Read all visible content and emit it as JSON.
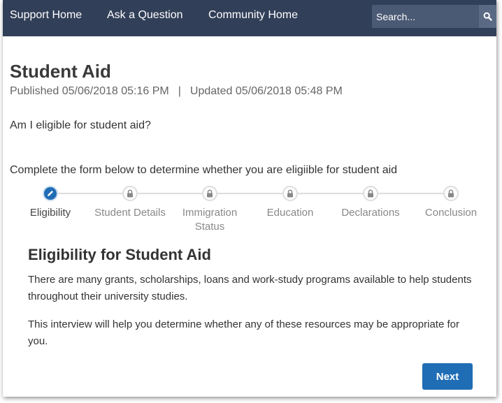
{
  "nav": {
    "links": [
      "Support Home",
      "Ask a Question",
      "Community Home"
    ],
    "search_placeholder": "Search..."
  },
  "article": {
    "title": "Student Aid",
    "published": "Published 05/06/2018 05:16 PM",
    "separator": "|",
    "updated": "Updated 05/06/2018 05:48 PM",
    "question": "Am I eligible for student aid?",
    "instructions": "Complete the form below to determine whether you are eligiible for student aid"
  },
  "stepper": {
    "steps": [
      {
        "label": "Eligibility",
        "state": "active",
        "icon": "pencil-icon"
      },
      {
        "label": "Student Details",
        "state": "locked",
        "icon": "lock-icon"
      },
      {
        "label": "Immigration Status",
        "state": "locked",
        "icon": "lock-icon"
      },
      {
        "label": "Education",
        "state": "locked",
        "icon": "lock-icon"
      },
      {
        "label": "Declarations",
        "state": "locked",
        "icon": "lock-icon"
      },
      {
        "label": "Conclusion",
        "state": "locked",
        "icon": "lock-icon"
      }
    ]
  },
  "section": {
    "title": "Eligibility for Student Aid",
    "paragraphs": [
      "There are many grants, scholarships, loans and work-study programs available to help students throughout their university studies.",
      "This interview will help you determine whether any of these resources may be appropriate for you."
    ]
  },
  "actions": {
    "next_label": "Next"
  },
  "colors": {
    "nav_bg": "#323f58",
    "accent": "#1f6db5"
  }
}
